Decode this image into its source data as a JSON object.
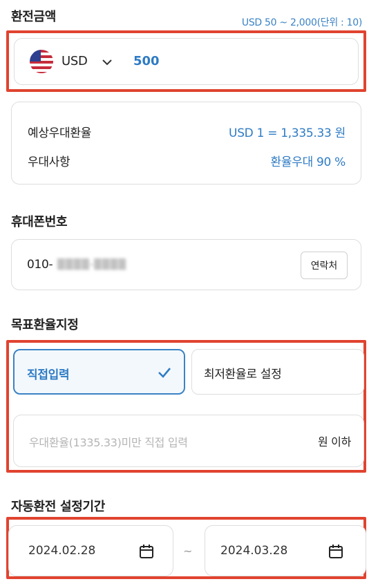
{
  "amount": {
    "title": "환전금액",
    "range_hint": "USD 50 ~ 2,000(단위 : 10)",
    "currency": "USD",
    "value": "500"
  },
  "rate_info": {
    "expected_rate_label": "예상우대환율",
    "expected_rate_value": "USD 1 = 1,335.33 원",
    "preference_label": "우대사항",
    "preference_value": "환율우대 90 %"
  },
  "phone": {
    "title": "휴대폰번호",
    "value": "010-",
    "masked": "▒▒▒▒-▒▒▒▒",
    "contacts_button": "연락처"
  },
  "target_rate": {
    "title": "목표환율지정",
    "option_direct": "직접입력",
    "option_lowest": "최저환율로 설정",
    "input_placeholder": "우대환율(1335.33)미만 직접 입력",
    "unit_suffix": "원 이하"
  },
  "period": {
    "title": "자동환전 설정기간",
    "start_date": "2024.02.28",
    "separator": "~",
    "end_date": "2024.03.28"
  },
  "colors": {
    "accent": "#2e7bc4",
    "highlight_frame": "#e0432f",
    "border": "#dddddd"
  },
  "icons": {
    "currency_flag": "us-flag-icon",
    "dropdown": "chevron-down-icon",
    "selected": "check-icon",
    "date": "calendar-icon"
  }
}
